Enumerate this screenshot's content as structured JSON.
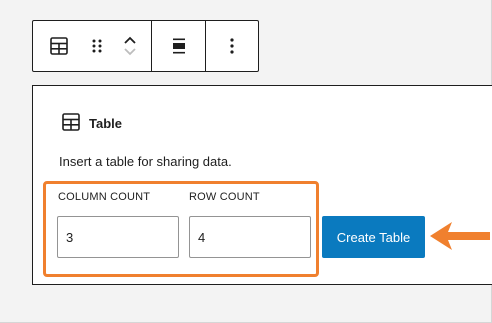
{
  "toolbar": {
    "icons": [
      "table-icon",
      "drag-handle-icon",
      "move-up-icon",
      "move-down-icon",
      "align-icon",
      "more-options-icon"
    ]
  },
  "block": {
    "title": "Table",
    "instructions": "Insert a table for sharing data.",
    "column_count_label": "COLUMN COUNT",
    "row_count_label": "ROW COUNT",
    "column_count_value": "3",
    "row_count_value": "4",
    "create_label": "Create Table"
  },
  "colors": {
    "accent": "#0a7abf",
    "highlight": "#f0802e",
    "border": "#1e1e1e"
  }
}
